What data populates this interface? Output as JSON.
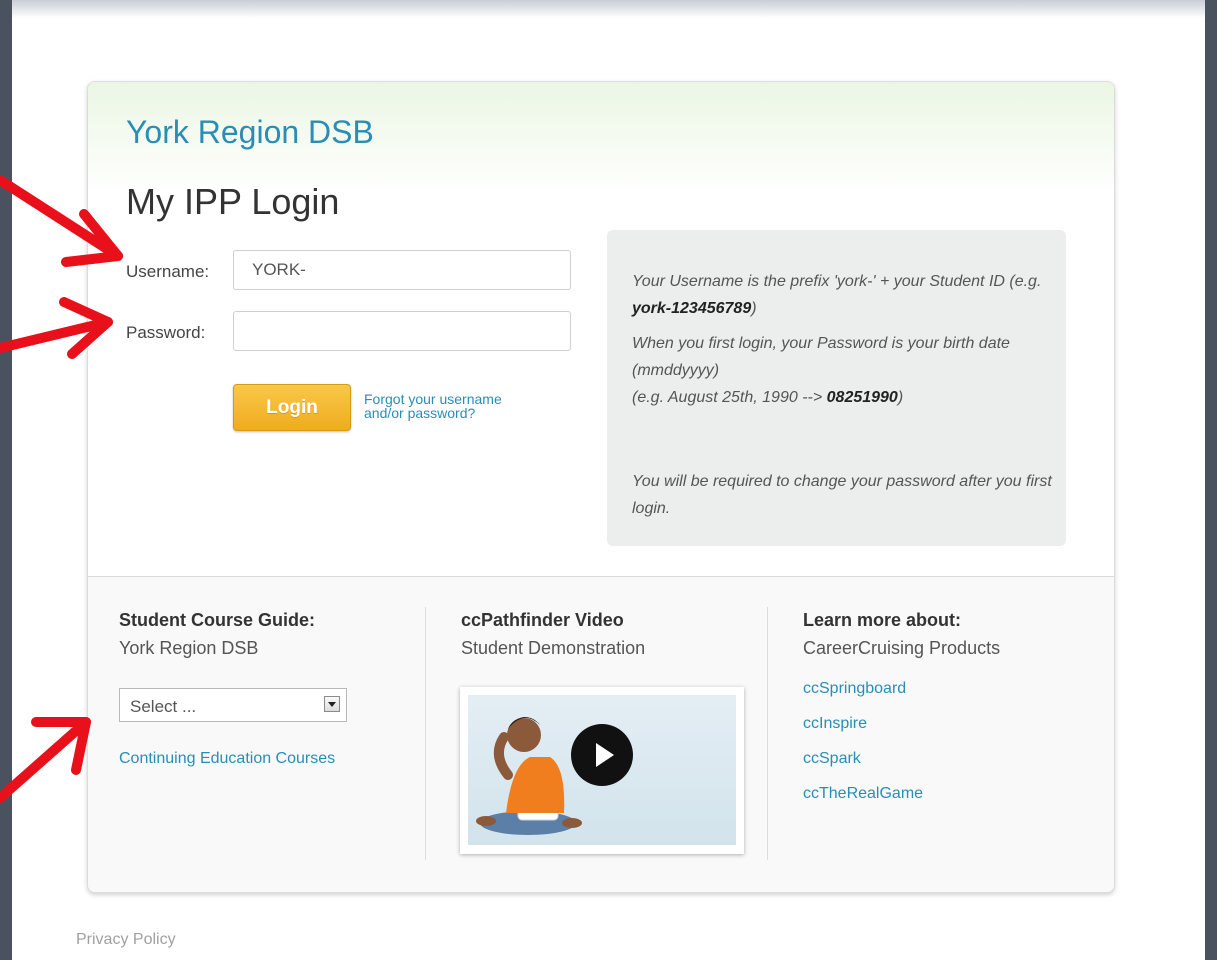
{
  "header": {
    "org_name": "York Region DSB",
    "title": "My IPP Login"
  },
  "form": {
    "username_label": "Username:",
    "username_value": "YORK-",
    "password_label": "Password:",
    "password_value": "",
    "login_label": "Login",
    "forgot_line1": "Forgot your username",
    "forgot_line2": "and/or password?"
  },
  "info": {
    "username_text": "Your Username is the prefix 'york-' + your Student ID (e.g. ",
    "username_example": "york-123456789",
    "username_close": ")",
    "password_text": "When you first login, your Password is your birth date (mmddyyyy)",
    "password_example_prefix": "(e.g. August 25th, 1990 --> ",
    "password_example": "08251990",
    "password_example_close": ")",
    "change_notice": "You will be required to change your password after you first login."
  },
  "course_guide": {
    "title": "Student Course Guide:",
    "subtitle": "York Region DSB",
    "select_value": "Select ...",
    "continuing_link": "Continuing Education Courses"
  },
  "video": {
    "title": "ccPathfinder Video",
    "subtitle": "Student Demonstration",
    "play_icon": "play-icon"
  },
  "products": {
    "title": "Learn more about:",
    "subtitle": "CareerCruising Products",
    "links": [
      "ccSpringboard",
      "ccInspire",
      "ccSpark",
      "ccTheRealGame"
    ]
  },
  "footer": {
    "privacy": "Privacy Policy"
  },
  "colors": {
    "link": "#2a8db5",
    "login_button": "#efac1e",
    "annotation_arrow": "#e8101a",
    "info_box_bg": "#ebeeed"
  }
}
